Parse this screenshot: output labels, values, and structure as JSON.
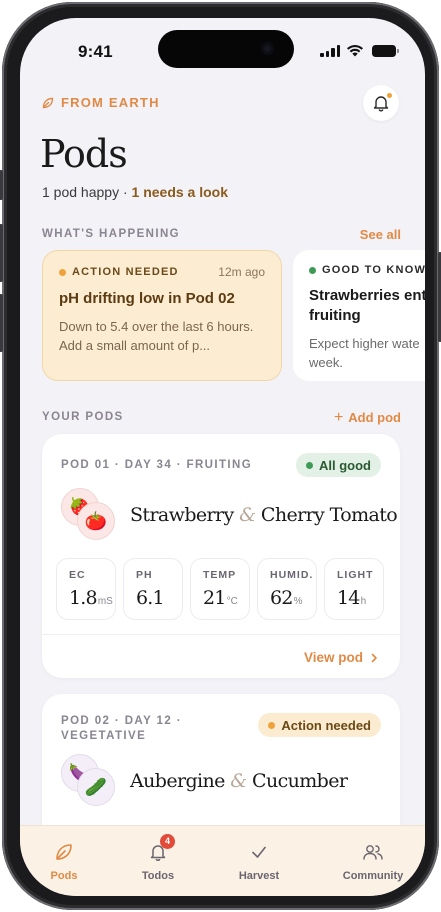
{
  "status_bar": {
    "time": "9:41"
  },
  "header": {
    "brand": "FROM EARTH",
    "title": "Pods",
    "subtitle_main": "1 pod happy · ",
    "subtitle_warn": "1 needs a look",
    "notification_icon": "bell-icon"
  },
  "happening": {
    "label": "WHAT'S HAPPENING",
    "see_all": "See all",
    "cards": [
      {
        "tag": "ACTION NEEDED",
        "time": "12m ago",
        "headline": "pH drifting low in Pod 02",
        "body": "Down to 5.4 over the last 6 hours. Add a small amount of p...",
        "dot_color": "#f0a23a"
      },
      {
        "tag": "GOOD TO KNOW",
        "headline_line1": "Strawberries ent",
        "headline_line2": "fruiting",
        "body_line1": "Expect higher wate",
        "body_line2": "week.",
        "dot_color": "#3f9a55"
      }
    ]
  },
  "pods_section": {
    "label": "YOUR PODS",
    "add_label": "Add pod"
  },
  "pods": [
    {
      "meta": "POD 01 · DAY 34 · FRUITING",
      "status": "All good",
      "status_color": "#3f9a55",
      "plant_a": "Strawberry",
      "amp": "&",
      "plant_b": "Cherry Tomato",
      "icons": [
        "strawberry",
        "tomato"
      ],
      "metrics": [
        {
          "label": "EC",
          "value": "1.8",
          "unit": "mS"
        },
        {
          "label": "PH",
          "value": "6.1",
          "unit": ""
        },
        {
          "label": "TEMP",
          "value": "21",
          "unit": "°C"
        },
        {
          "label": "HUMID.",
          "value": "62",
          "unit": "%"
        },
        {
          "label": "LIGHT",
          "value": "14",
          "unit": "h"
        }
      ],
      "view_label": "View pod"
    },
    {
      "meta_line1": "POD 02 · DAY 12 ·",
      "meta_line2": "VEGETATIVE",
      "status": "Action needed",
      "status_color": "#f0a23a",
      "plant_a": "Aubergine",
      "amp": "&",
      "plant_b": "Cucumber",
      "icons": [
        "eggplant",
        "cucumber"
      ]
    }
  ],
  "tabbar": {
    "tabs": [
      {
        "label": "Pods",
        "icon": "leaf-icon",
        "active": true
      },
      {
        "label": "Todos",
        "icon": "bell-icon",
        "badge": "4"
      },
      {
        "label": "Harvest",
        "icon": "check-icon"
      },
      {
        "label": "Community",
        "icon": "people-icon"
      }
    ]
  },
  "colors": {
    "accent": "#e08a46",
    "alert_bg": "#fcedd2",
    "good": "#3f9a55",
    "warn": "#f0a23a"
  }
}
